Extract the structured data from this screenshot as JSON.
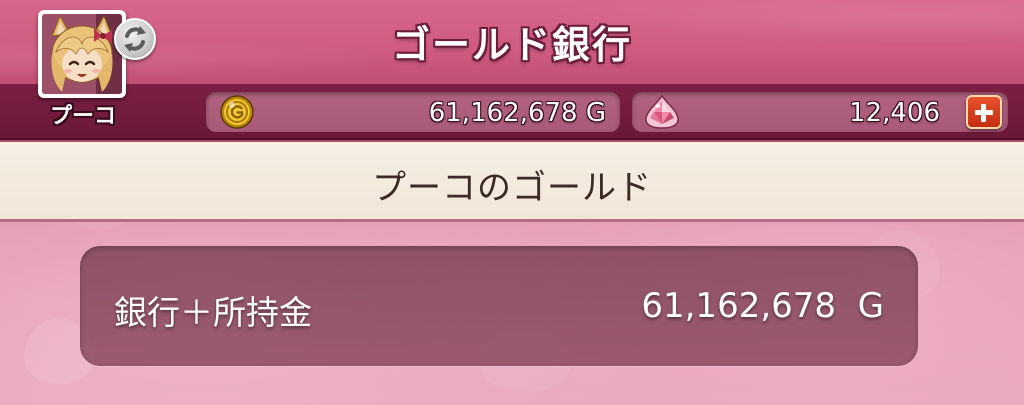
{
  "header": {
    "title": "ゴールド銀行"
  },
  "character": {
    "name": "プーコ",
    "avatar_icon": "character-portrait",
    "switch_icon": "switch-character-icon"
  },
  "currency": {
    "gold": {
      "icon": "gold-coin-icon",
      "value": "61,162,678 G"
    },
    "gems": {
      "icon": "gem-icon",
      "value": "12,406",
      "add_icon": "plus-icon"
    }
  },
  "section": {
    "title": "プーコのゴールド"
  },
  "balance": {
    "label": "銀行＋所持金",
    "value": "61,162,678  G"
  },
  "colors": {
    "header": "#cf5b80",
    "currency_bar": "#6a1838",
    "section_band": "#f4ebde",
    "panel": "#7d3e53",
    "add_button": "#d43f1c"
  }
}
